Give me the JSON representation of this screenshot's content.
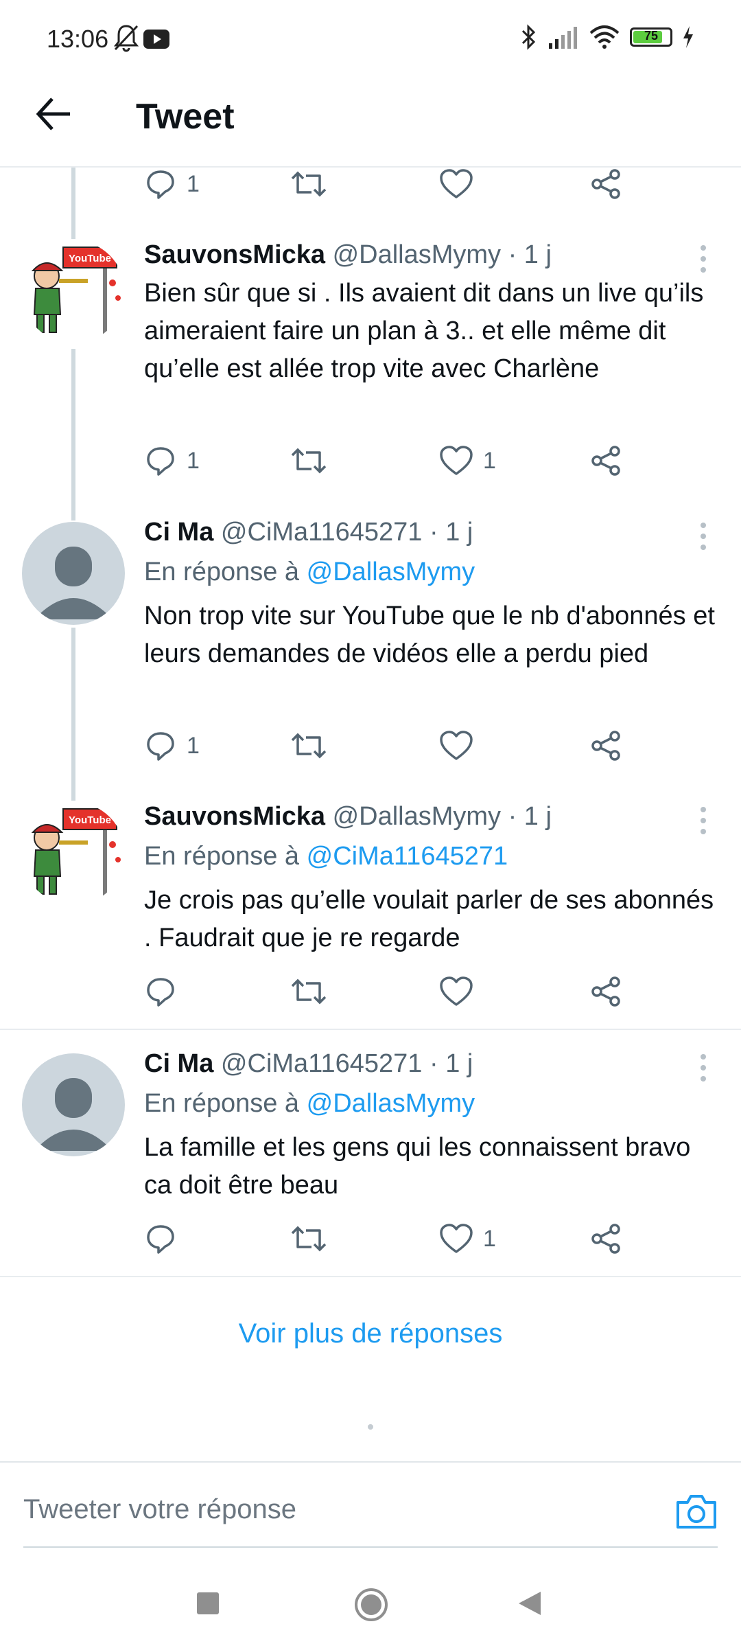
{
  "status_bar": {
    "time": "13:06",
    "battery": "75"
  },
  "header": {
    "title": "Tweet"
  },
  "top_actions": {
    "reply_count": "1",
    "like_count": ""
  },
  "tweets": [
    {
      "author": "SauvonsMicka",
      "handle_meta": "@DallasMymy · 1 j",
      "reply_to": "",
      "reply_to_handle": "",
      "text": "Bien sûr que si . Ils avaient dit dans un live qu’ils aimeraient faire un plan à 3.. et elle même dit qu’elle est allée trop vite avec Charlène",
      "reply_count": "1",
      "like_count": "1"
    },
    {
      "author": "Ci Ma",
      "handle_meta": "@CiMa11645271 · 1 j",
      "reply_to": "En réponse à",
      "reply_to_handle": "@DallasMymy",
      "text": "Non trop vite sur YouTube que le nb d'abonnés et leurs demandes de vidéos elle a perdu pied",
      "reply_count": "1",
      "like_count": ""
    },
    {
      "author": "SauvonsMicka",
      "handle_meta": "@DallasMymy · 1 j",
      "reply_to": "En réponse à",
      "reply_to_handle": "@CiMa11645271",
      "text": "Je crois pas qu’elle voulait parler de ses abonnés . Faudrait que je re regarde",
      "reply_count": "",
      "like_count": ""
    },
    {
      "author": "Ci Ma",
      "handle_meta": "@CiMa11645271 · 1 j",
      "reply_to": "En réponse à",
      "reply_to_handle": "@DallasMymy",
      "text": "La famille et les gens qui les connaissent bravo ca doit être beau",
      "reply_count": "",
      "like_count": "1"
    }
  ],
  "see_more": "Voir plus de réponses",
  "composer": {
    "placeholder": "Tweeter votre réponse"
  },
  "avatar_logo_text": "YouTube",
  "colors": {
    "accent": "#1d9bf0",
    "muted": "#536471",
    "thread_line": "#cfd9de",
    "battery_fill": "#5ccc3f"
  }
}
